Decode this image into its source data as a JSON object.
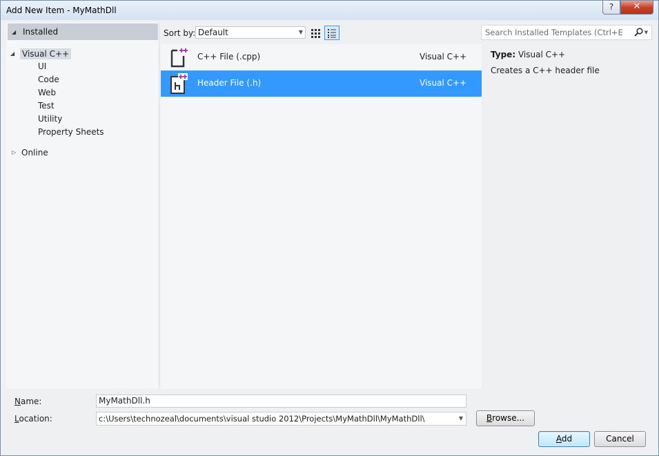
{
  "window": {
    "title": "Add New Item - MyMathDll",
    "help_label": "?",
    "close_label": "✕"
  },
  "tree": {
    "installed_label": "Installed",
    "visual_cpp_label": "Visual C++",
    "children": [
      "UI",
      "Code",
      "Web",
      "Test",
      "Utility",
      "Property Sheets"
    ],
    "online_label": "Online"
  },
  "sortbar": {
    "label": "Sort by:",
    "selected": "Default"
  },
  "templates": [
    {
      "name": "C++ File (.cpp)",
      "language": "Visual C++",
      "icon": "cpp-file-icon",
      "selected": false
    },
    {
      "name": "Header File (.h)",
      "language": "Visual C++",
      "icon": "header-file-icon",
      "selected": true
    }
  ],
  "search": {
    "placeholder": "Search Installed Templates (Ctrl+E)"
  },
  "details": {
    "type_label": "Type:",
    "type_value": "Visual C++",
    "description": "Creates a C++ header file"
  },
  "form": {
    "name_label_accel": "N",
    "name_label_rest": "ame:",
    "name_value": "MyMathDll.h",
    "location_label_accel": "L",
    "location_label_rest": "ocation:",
    "location_value": "c:\\Users\\technozeal\\documents\\visual studio 2012\\Projects\\MyMathDll\\MyMathDll\\",
    "browse_accel": "B",
    "browse_rest": "rowse...",
    "add_accel": "A",
    "add_rest": "dd",
    "cancel_label": "Cancel"
  },
  "colors": {
    "selection": "#3399ff",
    "panel_bg": "#f5f6f7",
    "installed_header_bg": "#c9ced6"
  }
}
